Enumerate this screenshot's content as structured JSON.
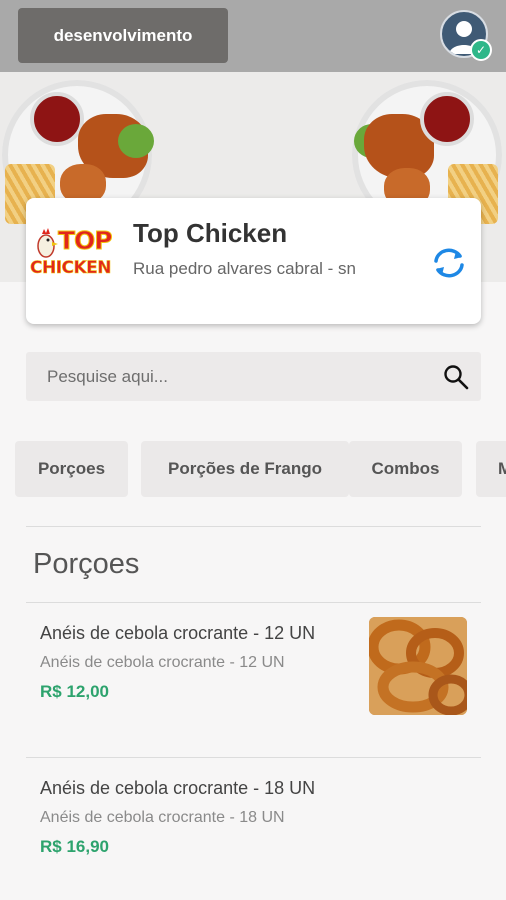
{
  "header": {
    "environment_label": "desenvolvimento",
    "avatar_icon": "user-avatar-icon",
    "verified_icon": "check-icon"
  },
  "shop": {
    "logo_top": "TOP",
    "logo_bottom": "CHICKEN",
    "name": "Top Chicken",
    "address": "Rua pedro alvares cabral - sn",
    "refresh_icon": "refresh-icon"
  },
  "search": {
    "placeholder": "Pesquise aqui...",
    "icon": "search-icon"
  },
  "categories": [
    {
      "label": "Porçoes"
    },
    {
      "label": "Porções de Frango"
    },
    {
      "label": "Combos"
    },
    {
      "label": "M"
    }
  ],
  "section": {
    "title": "Porçoes"
  },
  "products": [
    {
      "name": "Anéis de cebola crocrante - 12 UN",
      "description": "Anéis de cebola crocrante - 12 UN",
      "price": "R$ 12,00"
    },
    {
      "name": "Anéis de cebola crocrante - 18 UN",
      "description": "Anéis de cebola crocrante - 18 UN",
      "price": "R$ 16,90"
    }
  ],
  "colors": {
    "topbar": "#a9a9a9",
    "env_button": "#6e6c6a",
    "price": "#2da36d",
    "refresh": "#1e88e5",
    "verified": "#2fb789"
  }
}
